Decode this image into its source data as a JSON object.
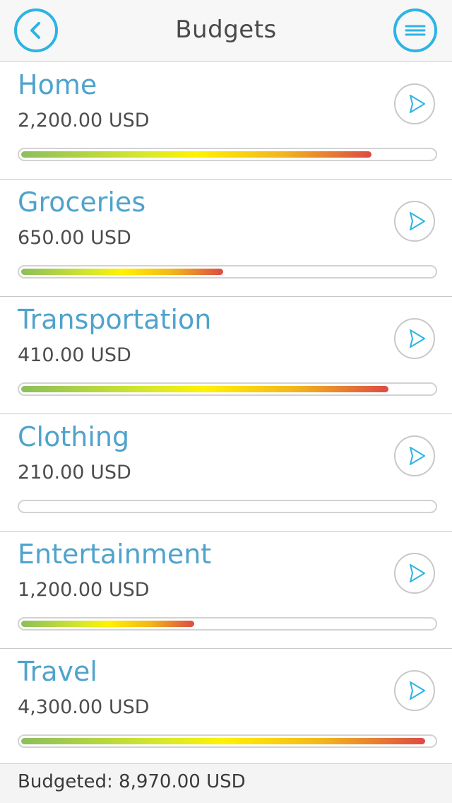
{
  "header": {
    "title": "Budgets",
    "back_icon": "chevron-left-icon",
    "menu_icon": "hamburger-menu-icon",
    "accent_color": "#2cb4e4"
  },
  "budgets": [
    {
      "name": "Home",
      "amount": "2,200.00 USD",
      "progress": 0.85
    },
    {
      "name": "Groceries",
      "amount": "650.00 USD",
      "progress": 0.49
    },
    {
      "name": "Transportation",
      "amount": "410.00 USD",
      "progress": 0.89
    },
    {
      "name": "Clothing",
      "amount": "210.00 USD",
      "progress": 0
    },
    {
      "name": "Entertainment",
      "amount": "1,200.00 USD",
      "progress": 0.42
    },
    {
      "name": "Travel",
      "amount": "4,300.00 USD",
      "progress": 0.98
    }
  ],
  "row_icon": "play-arrow-icon",
  "footer": {
    "summary": "Budgeted: 8,970.00 USD"
  }
}
